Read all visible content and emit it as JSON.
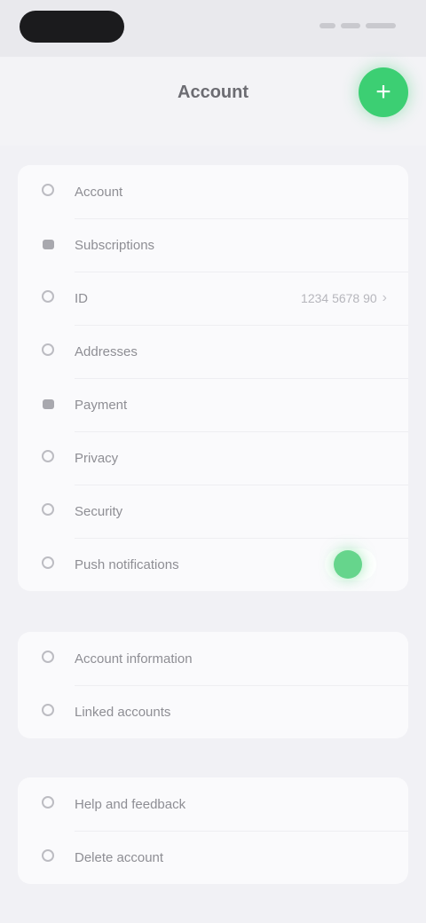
{
  "status_bar": {},
  "header": {
    "title": "Account",
    "action_label": "+",
    "action_icon": "plus-icon",
    "accent_color": "#3ccf73"
  },
  "groups": [
    {
      "items": [
        {
          "label": "Account",
          "icon": "person-icon"
        },
        {
          "label": "Subscriptions",
          "icon": "card-icon"
        },
        {
          "label": "ID",
          "icon": "id-icon",
          "value": "1234 5678 90"
        },
        {
          "label": "Addresses",
          "icon": "location-icon"
        },
        {
          "label": "Payment",
          "icon": "wallet-icon"
        },
        {
          "label": "Privacy",
          "icon": "lock-icon"
        },
        {
          "label": "Security",
          "icon": "shield-icon"
        },
        {
          "label": "Push notifications",
          "icon": "bell-icon",
          "toggle": true
        }
      ]
    },
    {
      "items": [
        {
          "label": "Account information",
          "icon": "info-icon"
        },
        {
          "label": "Linked accounts",
          "icon": "link-icon"
        }
      ]
    },
    {
      "items": [
        {
          "label": "Help and feedback",
          "icon": "help-icon"
        },
        {
          "label": "Delete account",
          "icon": "trash-icon"
        }
      ]
    }
  ]
}
